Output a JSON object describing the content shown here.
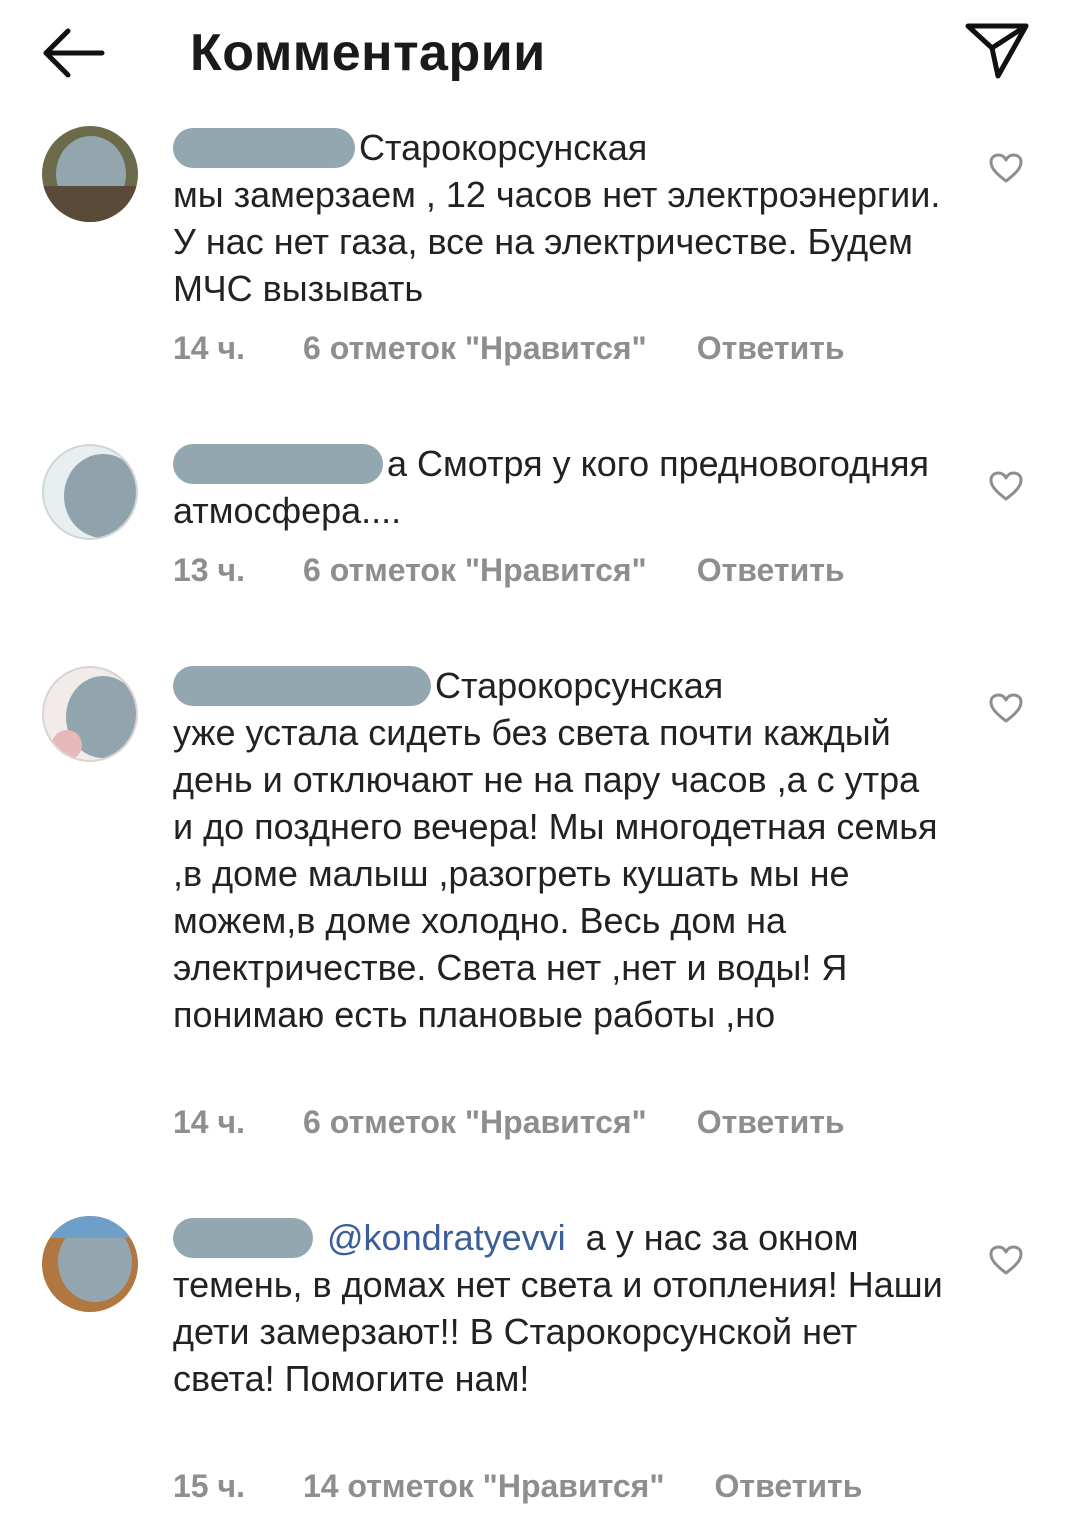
{
  "header": {
    "title": "Комментарии",
    "back_icon": "arrow-left-icon",
    "send_icon": "paper-plane-icon"
  },
  "comments": [
    {
      "username_fragment": "Старокорсунская",
      "text": "мы замерзаем , 12 часов нет электроэнергии. У нас нет газа, все на электричестве. Будем МЧС вызывать",
      "time": "14 ч.",
      "likes": "6 отметок \"Нравится\"",
      "reply": "Ответить"
    },
    {
      "username_fragment": "а",
      "text": "Смотря у кого предновогодняя  атмосфера....",
      "time": "13 ч.",
      "likes": "6 отметок \"Нравится\"",
      "reply": "Ответить"
    },
    {
      "username_fragment": "Старокорсунская",
      "text": "уже устала сидеть без света почти каждый день и отключают не на пару часов ,а с утра и до позднего вечера! Мы многодетная семья ,в доме малыш ,разогреть кушать мы не можем,в доме холодно. Весь дом на электричестве. Света нет ,нет и воды! Я понимаю есть плановые работы ,но",
      "time": "14 ч.",
      "likes": "6 отметок \"Нравится\"",
      "reply": "Ответить"
    },
    {
      "mention": "@kondratyevvi",
      "text": "а у нас за окном темень, в домах нет света и отопления! Наши дети замерзают!! В Старокорсунской нет света! Помогите нам!",
      "time": "15 ч.",
      "likes": "14 отметок \"Нравится\"",
      "reply": "Ответить"
    }
  ],
  "colors": {
    "meta_gray": "#8e8e8e",
    "mention_blue": "#3b5e9a",
    "redaction": "#93a7b1"
  }
}
